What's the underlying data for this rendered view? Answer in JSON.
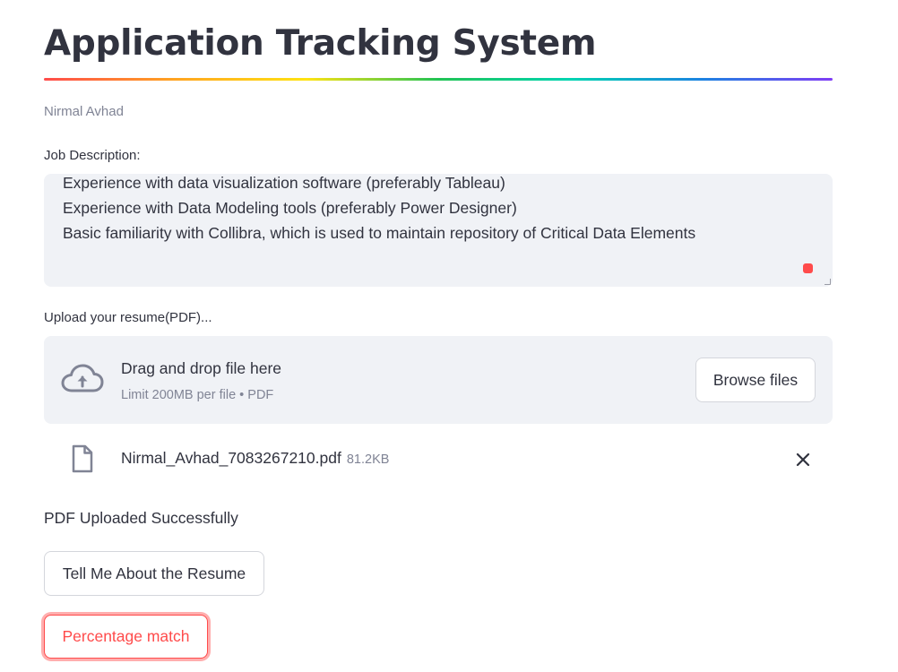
{
  "header": {
    "title": "Application Tracking System",
    "caption": "Nirmal Avhad"
  },
  "job_description": {
    "label": "Job Description:",
    "lines": [
      "Experience with data visualization software (preferably Tableau)",
      "Experience with Data Modeling tools (preferably Power Designer)",
      "Basic familiarity with Collibra, which is used to maintain repository of Critical Data Elements"
    ]
  },
  "uploader": {
    "label": "Upload your resume(PDF)...",
    "drop_text": "Drag and drop file here",
    "limit_text": "Limit 200MB per file • PDF",
    "browse_label": "Browse files",
    "icon": "cloud-upload-icon"
  },
  "uploaded_file": {
    "name": "Nirmal_Avhad_7083267210.pdf",
    "size": "81.2KB",
    "icon": "file-icon"
  },
  "status": {
    "message": "PDF Uploaded Successfully"
  },
  "actions": {
    "about_label": "Tell Me About the Resume",
    "match_label": "Percentage match"
  },
  "colors": {
    "accent": "#ff4b4b",
    "text": "#31333f",
    "muted": "#808495",
    "input_bg": "#f0f2f6"
  }
}
